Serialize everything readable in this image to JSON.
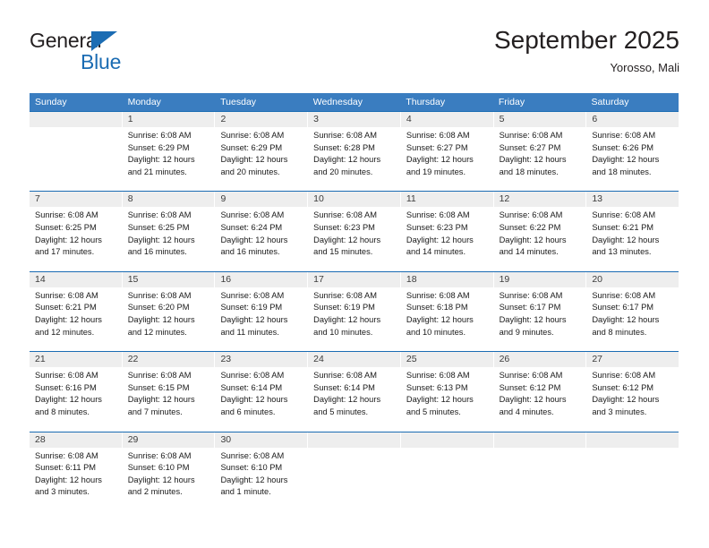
{
  "brand": {
    "name_part1": "General",
    "name_part2": "Blue",
    "accent_color": "#1b6cb3"
  },
  "header": {
    "title": "September 2025",
    "location": "Yorosso, Mali"
  },
  "calendar": {
    "header_bg": "#3a7dc0",
    "date_band_bg": "#eeeeee",
    "row_divider_color": "#1b6cb3",
    "weekdays": [
      "Sunday",
      "Monday",
      "Tuesday",
      "Wednesday",
      "Thursday",
      "Friday",
      "Saturday"
    ],
    "weeks": [
      [
        {
          "date": "",
          "sunrise": "",
          "sunset": "",
          "daylight": ""
        },
        {
          "date": "1",
          "sunrise": "Sunrise: 6:08 AM",
          "sunset": "Sunset: 6:29 PM",
          "daylight": "Daylight: 12 hours and 21 minutes."
        },
        {
          "date": "2",
          "sunrise": "Sunrise: 6:08 AM",
          "sunset": "Sunset: 6:29 PM",
          "daylight": "Daylight: 12 hours and 20 minutes."
        },
        {
          "date": "3",
          "sunrise": "Sunrise: 6:08 AM",
          "sunset": "Sunset: 6:28 PM",
          "daylight": "Daylight: 12 hours and 20 minutes."
        },
        {
          "date": "4",
          "sunrise": "Sunrise: 6:08 AM",
          "sunset": "Sunset: 6:27 PM",
          "daylight": "Daylight: 12 hours and 19 minutes."
        },
        {
          "date": "5",
          "sunrise": "Sunrise: 6:08 AM",
          "sunset": "Sunset: 6:27 PM",
          "daylight": "Daylight: 12 hours and 18 minutes."
        },
        {
          "date": "6",
          "sunrise": "Sunrise: 6:08 AM",
          "sunset": "Sunset: 6:26 PM",
          "daylight": "Daylight: 12 hours and 18 minutes."
        }
      ],
      [
        {
          "date": "7",
          "sunrise": "Sunrise: 6:08 AM",
          "sunset": "Sunset: 6:25 PM",
          "daylight": "Daylight: 12 hours and 17 minutes."
        },
        {
          "date": "8",
          "sunrise": "Sunrise: 6:08 AM",
          "sunset": "Sunset: 6:25 PM",
          "daylight": "Daylight: 12 hours and 16 minutes."
        },
        {
          "date": "9",
          "sunrise": "Sunrise: 6:08 AM",
          "sunset": "Sunset: 6:24 PM",
          "daylight": "Daylight: 12 hours and 16 minutes."
        },
        {
          "date": "10",
          "sunrise": "Sunrise: 6:08 AM",
          "sunset": "Sunset: 6:23 PM",
          "daylight": "Daylight: 12 hours and 15 minutes."
        },
        {
          "date": "11",
          "sunrise": "Sunrise: 6:08 AM",
          "sunset": "Sunset: 6:23 PM",
          "daylight": "Daylight: 12 hours and 14 minutes."
        },
        {
          "date": "12",
          "sunrise": "Sunrise: 6:08 AM",
          "sunset": "Sunset: 6:22 PM",
          "daylight": "Daylight: 12 hours and 14 minutes."
        },
        {
          "date": "13",
          "sunrise": "Sunrise: 6:08 AM",
          "sunset": "Sunset: 6:21 PM",
          "daylight": "Daylight: 12 hours and 13 minutes."
        }
      ],
      [
        {
          "date": "14",
          "sunrise": "Sunrise: 6:08 AM",
          "sunset": "Sunset: 6:21 PM",
          "daylight": "Daylight: 12 hours and 12 minutes."
        },
        {
          "date": "15",
          "sunrise": "Sunrise: 6:08 AM",
          "sunset": "Sunset: 6:20 PM",
          "daylight": "Daylight: 12 hours and 12 minutes."
        },
        {
          "date": "16",
          "sunrise": "Sunrise: 6:08 AM",
          "sunset": "Sunset: 6:19 PM",
          "daylight": "Daylight: 12 hours and 11 minutes."
        },
        {
          "date": "17",
          "sunrise": "Sunrise: 6:08 AM",
          "sunset": "Sunset: 6:19 PM",
          "daylight": "Daylight: 12 hours and 10 minutes."
        },
        {
          "date": "18",
          "sunrise": "Sunrise: 6:08 AM",
          "sunset": "Sunset: 6:18 PM",
          "daylight": "Daylight: 12 hours and 10 minutes."
        },
        {
          "date": "19",
          "sunrise": "Sunrise: 6:08 AM",
          "sunset": "Sunset: 6:17 PM",
          "daylight": "Daylight: 12 hours and 9 minutes."
        },
        {
          "date": "20",
          "sunrise": "Sunrise: 6:08 AM",
          "sunset": "Sunset: 6:17 PM",
          "daylight": "Daylight: 12 hours and 8 minutes."
        }
      ],
      [
        {
          "date": "21",
          "sunrise": "Sunrise: 6:08 AM",
          "sunset": "Sunset: 6:16 PM",
          "daylight": "Daylight: 12 hours and 8 minutes."
        },
        {
          "date": "22",
          "sunrise": "Sunrise: 6:08 AM",
          "sunset": "Sunset: 6:15 PM",
          "daylight": "Daylight: 12 hours and 7 minutes."
        },
        {
          "date": "23",
          "sunrise": "Sunrise: 6:08 AM",
          "sunset": "Sunset: 6:14 PM",
          "daylight": "Daylight: 12 hours and 6 minutes."
        },
        {
          "date": "24",
          "sunrise": "Sunrise: 6:08 AM",
          "sunset": "Sunset: 6:14 PM",
          "daylight": "Daylight: 12 hours and 5 minutes."
        },
        {
          "date": "25",
          "sunrise": "Sunrise: 6:08 AM",
          "sunset": "Sunset: 6:13 PM",
          "daylight": "Daylight: 12 hours and 5 minutes."
        },
        {
          "date": "26",
          "sunrise": "Sunrise: 6:08 AM",
          "sunset": "Sunset: 6:12 PM",
          "daylight": "Daylight: 12 hours and 4 minutes."
        },
        {
          "date": "27",
          "sunrise": "Sunrise: 6:08 AM",
          "sunset": "Sunset: 6:12 PM",
          "daylight": "Daylight: 12 hours and 3 minutes."
        }
      ],
      [
        {
          "date": "28",
          "sunrise": "Sunrise: 6:08 AM",
          "sunset": "Sunset: 6:11 PM",
          "daylight": "Daylight: 12 hours and 3 minutes."
        },
        {
          "date": "29",
          "sunrise": "Sunrise: 6:08 AM",
          "sunset": "Sunset: 6:10 PM",
          "daylight": "Daylight: 12 hours and 2 minutes."
        },
        {
          "date": "30",
          "sunrise": "Sunrise: 6:08 AM",
          "sunset": "Sunset: 6:10 PM",
          "daylight": "Daylight: 12 hours and 1 minute."
        },
        {
          "date": "",
          "sunrise": "",
          "sunset": "",
          "daylight": ""
        },
        {
          "date": "",
          "sunrise": "",
          "sunset": "",
          "daylight": ""
        },
        {
          "date": "",
          "sunrise": "",
          "sunset": "",
          "daylight": ""
        },
        {
          "date": "",
          "sunrise": "",
          "sunset": "",
          "daylight": ""
        }
      ]
    ]
  }
}
